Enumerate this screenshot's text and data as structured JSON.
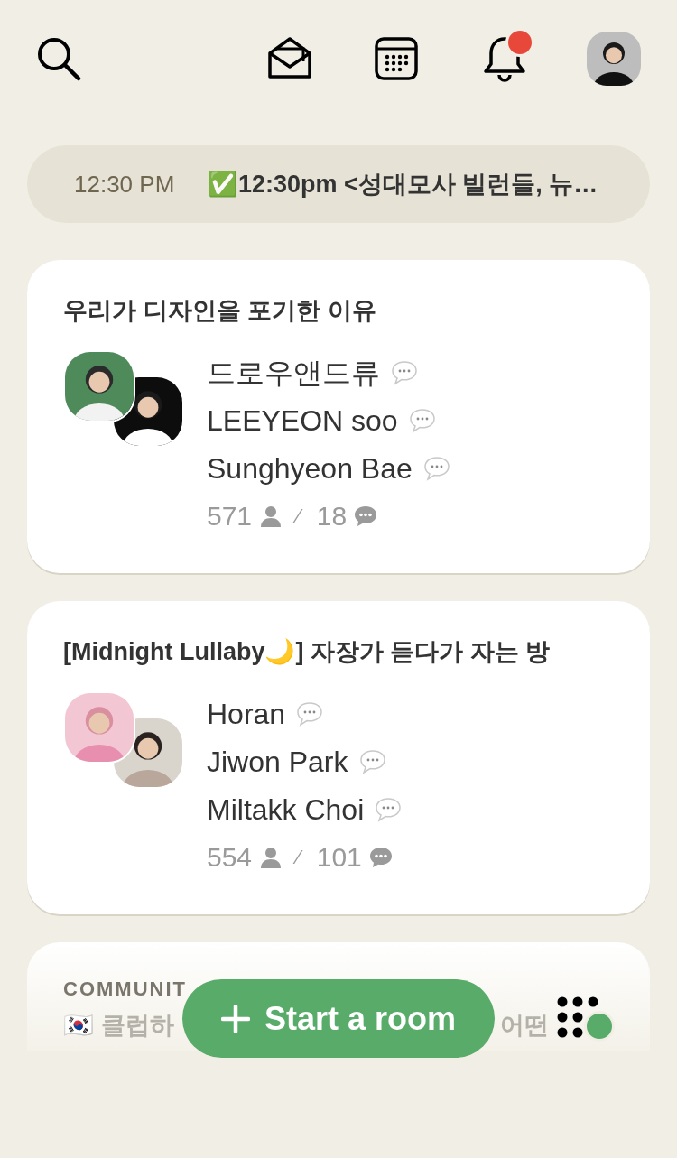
{
  "top_bar": {
    "notification_badge": true
  },
  "upcoming": {
    "time": "12:30 PM",
    "title": "✅12:30pm <성대모사 빌런들, 뉴…"
  },
  "rooms": [
    {
      "title": "우리가 디자인을 포기한 이유",
      "speakers": [
        "드로우앤드류",
        "LEEYEON soo",
        "Sunghyeon Bae"
      ],
      "listeners": "571",
      "separator": "⁄",
      "messages": "18"
    },
    {
      "title": "[Midnight Lullaby🌙] 자장가 듣다가 자는 방",
      "speakers": [
        "Horan",
        "Jiwon Park",
        "Miltakk Choi"
      ],
      "listeners": "554",
      "separator": "⁄",
      "messages": "101"
    }
  ],
  "partial_room": {
    "label": "COMMUNIT",
    "title_start": "🇰🇷 클럽하",
    "title_end": "어떤"
  },
  "start_button": "Start a room",
  "online_indicator": true
}
